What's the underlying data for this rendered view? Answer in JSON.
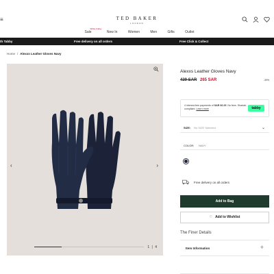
{
  "header": {
    "menu_label": "≡",
    "logo": "TED BAKER",
    "logo_sub": "LONDON",
    "nav": [
      {
        "label": "Sale",
        "tag": "White Friday"
      },
      {
        "label": "New In"
      },
      {
        "label": "Women"
      },
      {
        "label": "Men"
      },
      {
        "label": "Gifts"
      },
      {
        "label": "Outlet"
      }
    ],
    "icons": [
      "search-icon",
      "account-icon",
      "wishlist-icon"
    ]
  },
  "promo": {
    "left": "th Tabby",
    "center": "Free delivery on all orders",
    "right": "Free Click & Collect",
    "bg": "#1a1a1a"
  },
  "breadcrumb": {
    "home": "Home",
    "separator": "/",
    "current": "Alexxs Leather Gloves Navy"
  },
  "gallery": {
    "prev": "‹",
    "next": "›",
    "counter": "1 | 4",
    "progress": 0.25,
    "bg": "#e4dfda"
  },
  "product": {
    "title": "Alexxs Leather Gloves Navy",
    "price_old": "439 SAR",
    "price_new": "265 SAR",
    "discount": "-39%",
    "price_color": "#c8102e"
  },
  "tabby": {
    "text_before": "4 interest-free payments of",
    "amount": "SAR 66.25",
    "text_after": ". No fees. Shariah-compliant.",
    "link": "Learn more",
    "badge": "tabby",
    "badge_color": "#3affa3"
  },
  "size": {
    "label": "SIZE:",
    "value": "No SIZE Selected"
  },
  "color": {
    "label": "COLOR:",
    "value": "NAVY",
    "swatch": "#1a2450"
  },
  "delivery": {
    "text": "Free delivery on all orders"
  },
  "actions": {
    "add_to_bag": "Add to Bag",
    "add_to_wishlist": "Add to Wishlist",
    "bag_color": "#1f3b2e"
  },
  "details": {
    "heading": "The Finer Details",
    "item_info": "Item Information",
    "expand": "+"
  }
}
